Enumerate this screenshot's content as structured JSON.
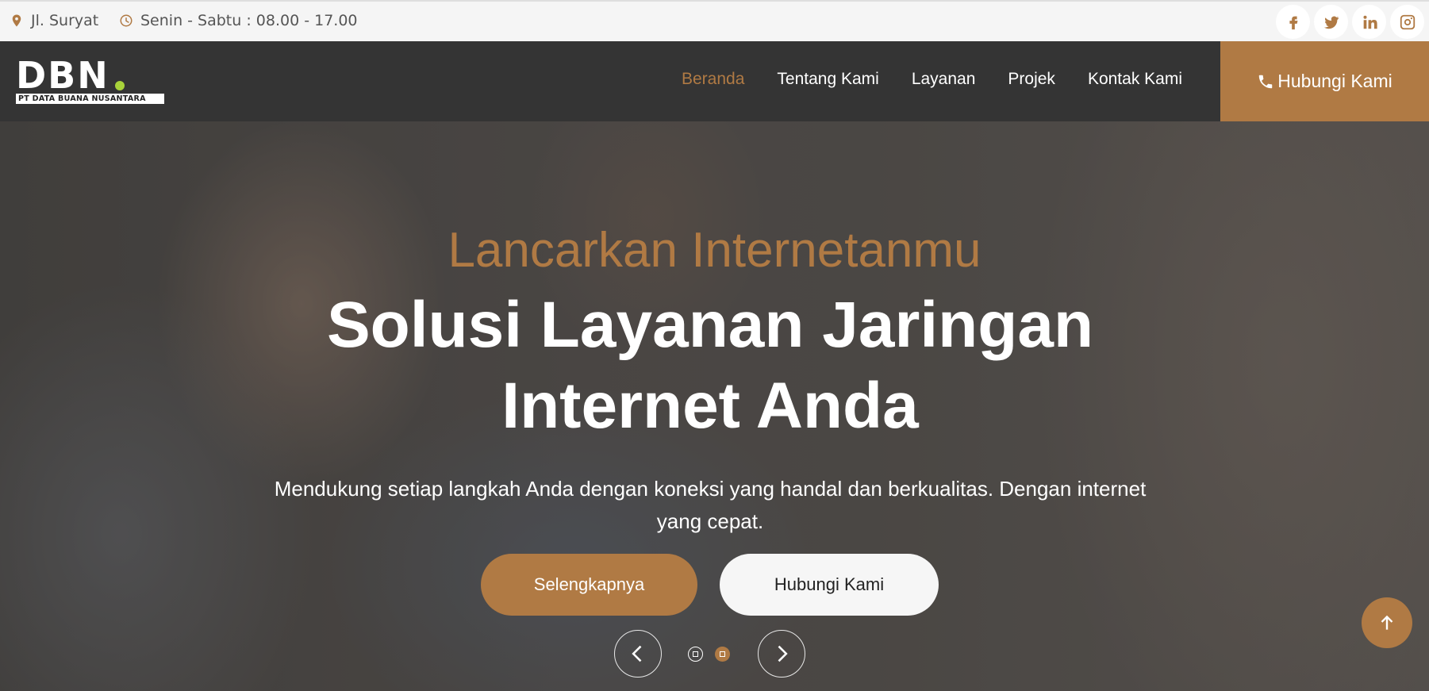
{
  "topbar": {
    "address": "Jl. Suryat",
    "hours": "Senin - Sabtu : 08.00 - 17.00",
    "social": [
      "facebook-icon",
      "twitter-icon",
      "linkedin-icon",
      "instagram-icon"
    ]
  },
  "nav": {
    "logo_text": "DBN",
    "logo_subtitle": "PT DATA BUANA NUSANTARA",
    "items": [
      {
        "label": "Beranda",
        "active": true
      },
      {
        "label": "Tentang Kami",
        "active": false
      },
      {
        "label": "Layanan",
        "active": false
      },
      {
        "label": "Projek",
        "active": false
      },
      {
        "label": "Kontak Kami",
        "active": false
      }
    ],
    "cta_label": "Hubungi Kami"
  },
  "hero": {
    "eyebrow": "Lancarkan Internetanmu",
    "headline": "Solusi Layanan Jaringan Internet Anda",
    "description": "Mendukung setiap langkah Anda dengan koneksi yang handal dan berkualitas. Dengan internet yang cepat.",
    "primary_button": "Selengkapnya",
    "secondary_button": "Hubungi Kami",
    "slide_count": 2,
    "active_slide": 2
  },
  "colors": {
    "accent": "#b07a44",
    "nav_background": "#343434",
    "topbar_background": "#f5f5f5"
  }
}
